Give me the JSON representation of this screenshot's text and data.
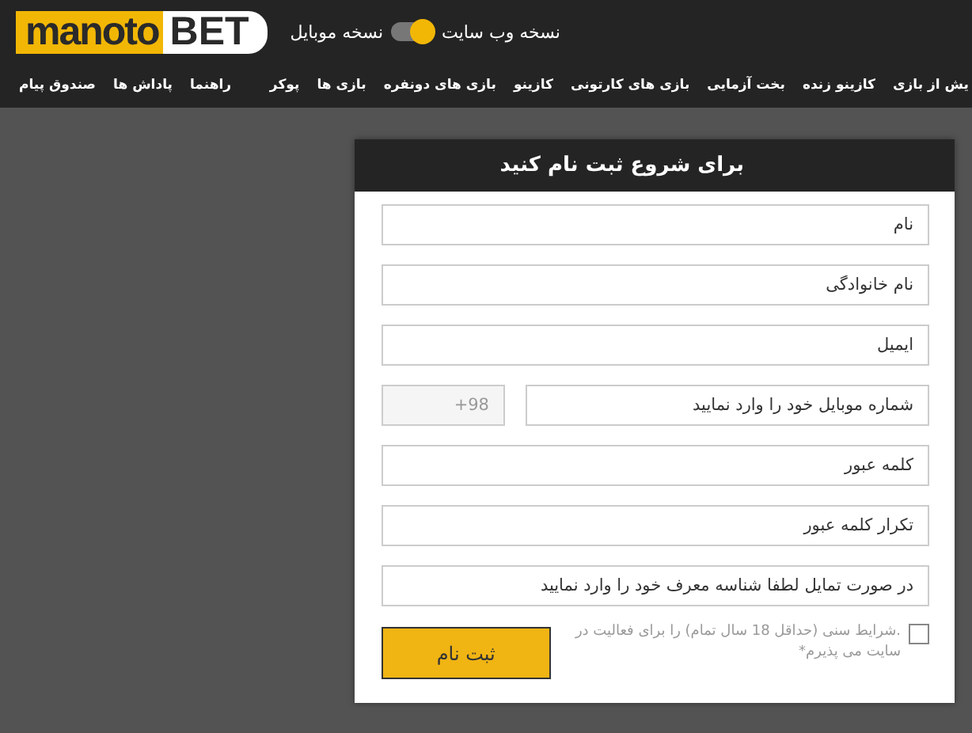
{
  "logo": {
    "part_1": "manoto",
    "part_2": "BET"
  },
  "version_switch": {
    "web_label": "نسخه وب سایت",
    "mobile_label": "نسخه موبایل",
    "on": true
  },
  "nav_main": [
    "یش از بازی",
    "کازینو زنده",
    "بخت آزمایی",
    "بازی های کارتونی",
    "کازینو",
    "بازی های دونفره",
    "بازی ها",
    "پوکر"
  ],
  "nav_user": [
    "راهنما",
    "پاداش ها",
    "صندوق پیام"
  ],
  "form": {
    "title": "برای شروع ثبت نام کنید",
    "fields": [
      {
        "kind": "text",
        "placeholder": "نام"
      },
      {
        "kind": "text",
        "placeholder": "نام خانوادگی"
      },
      {
        "kind": "text",
        "placeholder": "ایمیل"
      },
      {
        "kind": "phone",
        "placeholder": "شماره موبایل خود را وارد نمایید",
        "prefix": "+98"
      },
      {
        "kind": "text",
        "placeholder": "کلمه عبور"
      },
      {
        "kind": "text",
        "placeholder": "تکرار کلمه عبور"
      },
      {
        "kind": "text",
        "placeholder": "در صورت تمایل لطفا شناسه معرف خود را وارد نمایید"
      }
    ],
    "terms": {
      "text": ".شرایط سنی (حداقل 18 سال تمام) را برای فعالیت در سایت می پذیرم*",
      "checked": false
    },
    "submit": "ثبت نام"
  }
}
